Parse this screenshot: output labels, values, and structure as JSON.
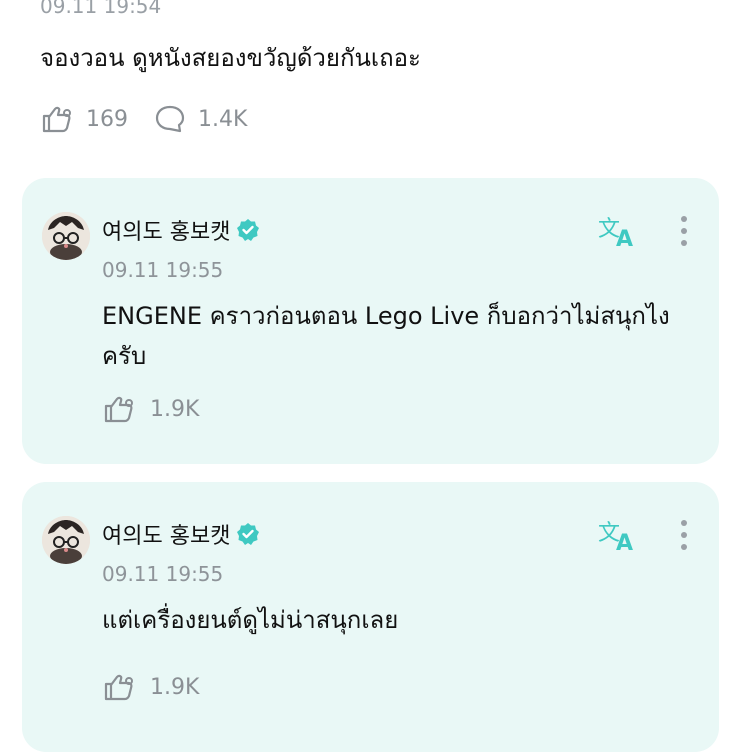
{
  "post": {
    "timestamp": "09.11 19:54",
    "text": "จองวอน ดูหนังสยองขวัญด้วยกันเถอะ",
    "likes": "169",
    "comments": "1.4K"
  },
  "replies": [
    {
      "author": "여의도 홍보캣",
      "timestamp": "09.11 19:55",
      "text": "ENGENE คราวก่อนตอน Lego Live ก็บอกว่าไม่สนุกไงครับ",
      "likes": "1.9K"
    },
    {
      "author": "여의도 홍보캣",
      "timestamp": "09.11 19:55",
      "text": "แต่เครื่องยนต์ดูไม่น่าสนุกเลย",
      "likes": "1.9K"
    }
  ],
  "colors": {
    "card_bg": "#e9f8f6",
    "accent": "#3fc9c2",
    "muted": "#8a8f94"
  },
  "icons": {
    "like": "like-icon",
    "comment": "comment-icon",
    "translate": "translate-icon",
    "more": "more-icon",
    "verified": "verified-badge-icon"
  }
}
